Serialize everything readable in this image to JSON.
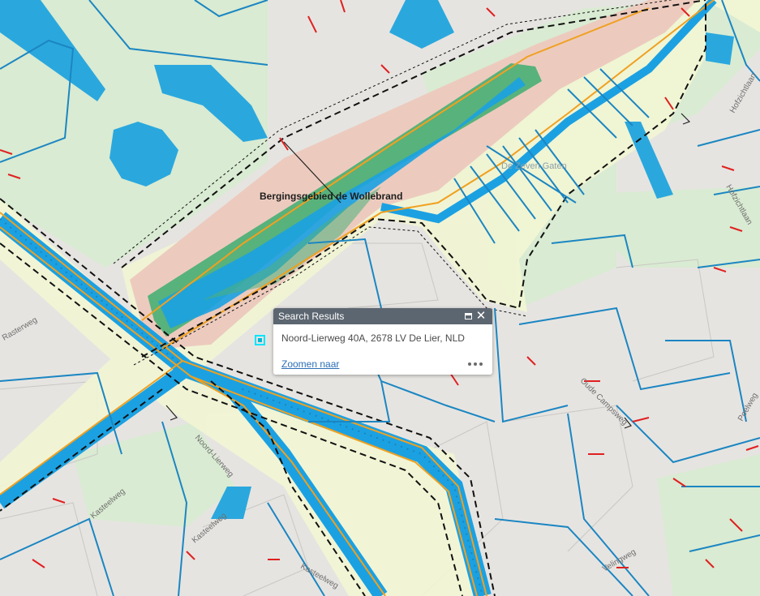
{
  "map": {
    "area_label": "Bergingsgebied de Wollebrand",
    "area_label_faint": "De Zeven Gaten",
    "roads": [
      "Noord-Lierweg",
      "Kasteelweg",
      "Kasteelweg",
      "Kasteelweg",
      "Velingweg",
      "Hofzichtlaan",
      "Hofzichtlaan",
      "Oude Campsweg",
      "Poelweg",
      "Rasterweg"
    ],
    "colors": {
      "background": "#e6e4e1",
      "park": "#d9ebd2",
      "buffer": "#f2f6d4",
      "basin_fill": "#eccbbe",
      "water": "#1ba1e2",
      "water_dark": "#1a8fc4",
      "wetland": "#58b27b",
      "road": "#f0a020",
      "ditch": "#1b86c2",
      "culvert": "#e02020",
      "boundary": "#111111"
    },
    "icons": [
      "selected-location-marker-icon"
    ]
  },
  "popup": {
    "title": "Search Results",
    "address": "Noord-Lierweg 40A, 2678 LV De Lier, NLD",
    "zoom_link": "Zoomen naar",
    "maximize_icon": "maximize-icon",
    "close_icon": "close-icon",
    "more_icon": "more-options-icon"
  }
}
